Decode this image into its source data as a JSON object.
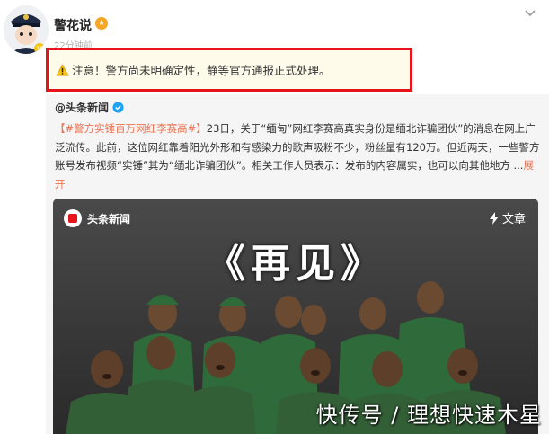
{
  "post": {
    "author": "警花说",
    "time": "22分钟前"
  },
  "notice": {
    "text": "注意！警方尚未明确定性，静等官方通报正式处理。"
  },
  "repost": {
    "source": "@头条新闻",
    "hashtag": "【#警方实锤百万网红李赛高#】",
    "body": "23日，关于“缅甸”网红李赛高真实身份是缅北诈骗团伙”的消息在网上广泛流传。此前，这位网红靠着阳光外形和有感染力的歌声吸粉不少，粉丝量有120万。但近两天，一些警方账号发布视频“实锤”其为“缅北诈骗团伙”。相关工作人员表示：发布的内容属实，也可以向其他地方 ...",
    "expand": "展开"
  },
  "video": {
    "logo_text": "头条新闻",
    "tag": "文章",
    "title": "《再见》"
  },
  "watermark": "快传号 / 理想快速木星",
  "colors": {
    "notice_border": "#e8141c",
    "hashtag": "#eb7350",
    "uniform": "#2f6b3a"
  }
}
